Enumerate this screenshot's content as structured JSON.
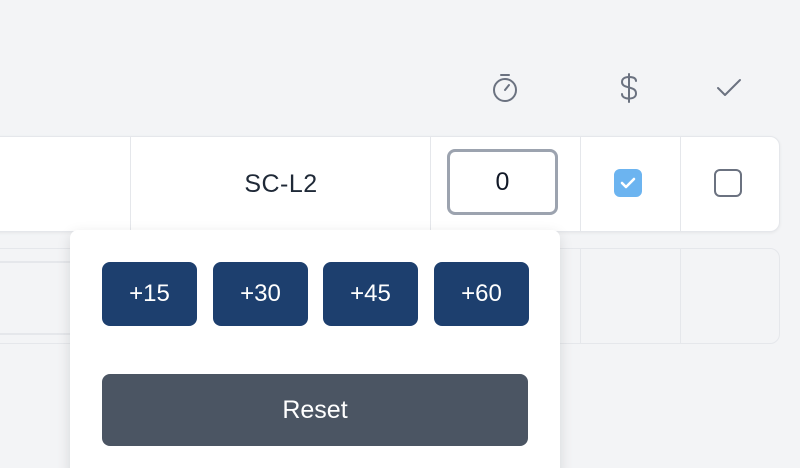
{
  "header": {
    "icons": [
      "stopwatch-icon",
      "dollar-icon",
      "check-icon"
    ]
  },
  "row": {
    "code": "SC-L2",
    "time_value": "0",
    "billable_checked": true,
    "done_checked": false
  },
  "popover": {
    "increments": [
      "+15",
      "+30",
      "+45",
      "+60"
    ],
    "reset_label": "Reset"
  },
  "colors": {
    "increment_bg": "#1d3f6e",
    "reset_bg": "#4b5563",
    "checkbox_on": "#6cb4f0"
  }
}
